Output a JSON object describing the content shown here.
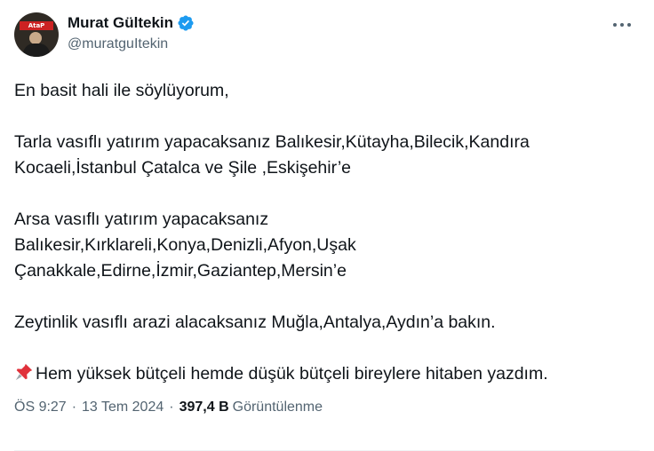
{
  "author": {
    "display_name": "Murat Gültekin",
    "handle": "@muratguItekin",
    "verified": true,
    "avatar_banner_text": "AtaP"
  },
  "tweet": {
    "paragraphs": [
      "En basit hali ile söylüyorum,",
      "Tarla vasıflı yatırım yapacaksanız Balıkesir,Kütayha,Bilecik,Kandıra\nKocaeli,İstanbul Çatalca ve Şile ,Eskişehir’e",
      "Arsa vasıflı yatırım yapacaksanız\nBalıkesir,Kırklareli,Konya,Denizli,Afyon,Uşak\nÇanakkale,Edirne,İzmir,Gaziantep,Mersin’e",
      "Zeytinlik vasıflı arazi alacaksanız Muğla,Antalya,Aydın’a bakın."
    ],
    "pinned_line": "Hem yüksek bütçeli hemde düşük bütçeli bireylere hitaben yazdım."
  },
  "meta": {
    "time": "ÖS 9:27",
    "date": "13 Tem 2024",
    "views_count": "397,4 B",
    "views_label": "Görüntülenme",
    "separator": "·"
  },
  "icons": {
    "verified": "verified-badge-icon",
    "more": "more-horizontal-icon",
    "pin": "pushpin-icon"
  },
  "colors": {
    "verified_blue": "#1d9bf0",
    "secondary_text": "#536471",
    "primary_text": "#0f1419",
    "pin_red": "#e0313a"
  }
}
